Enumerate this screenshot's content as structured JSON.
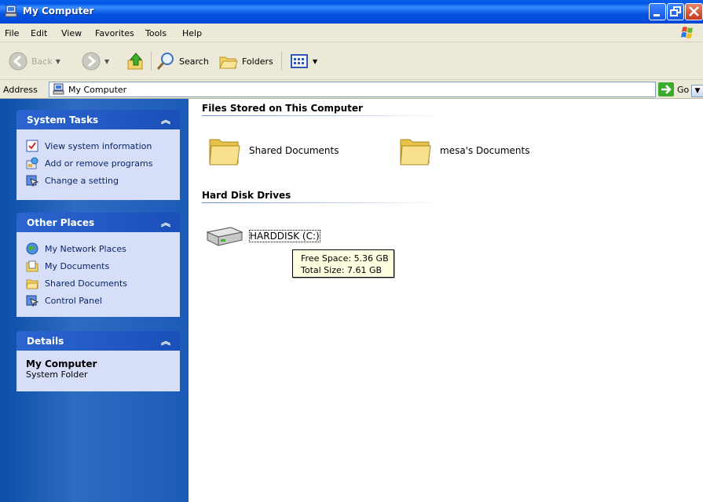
{
  "window": {
    "title": "My Computer"
  },
  "menu": {
    "items": [
      "File",
      "Edit",
      "View",
      "Favorites",
      "Tools",
      "Help"
    ]
  },
  "toolbar": {
    "back_label": "Back",
    "search_label": "Search",
    "folders_label": "Folders"
  },
  "address": {
    "label": "Address",
    "value": "My Computer",
    "go_label": "Go"
  },
  "left_pane": {
    "system_tasks": {
      "title": "System Tasks",
      "items": [
        "View system information",
        "Add or remove programs",
        "Change a setting"
      ]
    },
    "other_places": {
      "title": "Other Places",
      "items": [
        "My Network Places",
        "My Documents",
        "Shared Documents",
        "Control Panel"
      ]
    },
    "details": {
      "title": "Details",
      "name": "My Computer",
      "type": "System Folder"
    }
  },
  "main": {
    "files_group": "Files Stored on This Computer",
    "files": [
      "Shared Documents",
      "mesa's Documents"
    ],
    "drives_group": "Hard Disk Drives",
    "drives": [
      "HARDDISK (C:)"
    ],
    "tooltip": {
      "free_space": "Free Space: 5.36 GB",
      "total_size": "Total Size: 7.61 GB"
    }
  },
  "colors": {
    "title_bar": "#0058e6",
    "left_pane": "#2e6bc3",
    "panel_body": "#d6dff7",
    "link_text": "#0a246a"
  }
}
